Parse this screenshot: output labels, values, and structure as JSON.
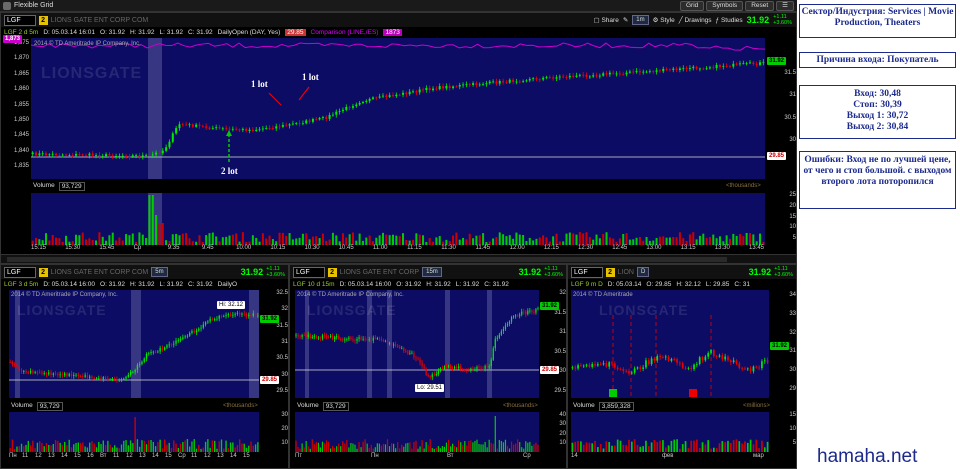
{
  "window": {
    "title": "Flexible Grid",
    "buttons": [
      "Grid",
      "Symbols",
      "Reset"
    ]
  },
  "main_chart": {
    "symbol": "LGF",
    "link": "2",
    "company": "LIONS GATE ENT CORP COM",
    "toolbar": [
      "Share",
      "1m",
      "Style",
      "Drawings",
      "Studies"
    ],
    "price": "31.92",
    "change_abs": "+1.11",
    "change_pct": "+3.60%",
    "info": [
      "LGF 2 d 5m",
      "D: 05.03.14 16:01",
      "O: 31.92",
      "H: 31.92",
      "L: 31.92",
      "C: 31.92",
      "DailyOpen (DAY, Yes)",
      "29.85",
      "Comparison (LINE,/ES)",
      "1873"
    ],
    "copyright": "2014 © TD Ameritrade IP Company, Inc.",
    "watermark": "LIONSGATE",
    "left_scale": [
      "1,875",
      "1,870",
      "1,865",
      "1,860",
      "1,855",
      "1,850",
      "1,845",
      "1,840",
      "1,835"
    ],
    "left_tag": "1,873",
    "right_scale": [
      "31.5",
      "31",
      "30.5",
      "30"
    ],
    "right_tags": {
      "last": "31.92",
      "open": "29.85"
    },
    "volume_label": "Volume",
    "volume_value": "93,729",
    "volume_unit": "<thousands>",
    "volume_scale": [
      "25",
      "20",
      "15",
      "10",
      "5"
    ],
    "time_axis": [
      "15:15",
      "15:30",
      "15:45",
      "Ср",
      "9:35",
      "9:45",
      "10:00",
      "10:15",
      "10:30",
      "10:45",
      "11:00",
      "11:15",
      "11:30",
      "11:45",
      "12:00",
      "12:15",
      "12:30",
      "12:45",
      "13:00",
      "13:15",
      "13:30",
      "13:45"
    ],
    "annotations": {
      "lot1a": "1 lot",
      "lot1b": "1 lot",
      "lot2": "2 lot"
    }
  },
  "chart_a": {
    "symbol": "LGF",
    "link": "2",
    "company": "LIONS GATE ENT CORP COM",
    "tf": "5m",
    "price": "31.92",
    "change_abs": "+1.11",
    "change_pct": "+3.60%",
    "info": [
      "LGF 3 d 5m",
      "D: 05.03.14 16:00",
      "O: 31.92",
      "H: 31.92",
      "L: 31.92",
      "C: 31.92",
      "DailyO"
    ],
    "copyright": "2014 © TD Ameritrade IP Company, Inc.",
    "hi_label": "Hi: 32.12",
    "tags": {
      "last": "31.92",
      "open": "29.85"
    },
    "right_scale": [
      "32.5",
      "32",
      "31.5",
      "31",
      "30.5",
      "30",
      "29.5"
    ],
    "volume_value": "93,729",
    "volume_unit": "<thousands>",
    "volume_scale": [
      "30",
      "20",
      "10"
    ],
    "time_axis": [
      "Пн",
      "11",
      "12",
      "13",
      "14",
      "15",
      "16",
      "Вт",
      "11",
      "12",
      "13",
      "14",
      "15",
      "Ср",
      "11",
      "12",
      "13",
      "14",
      "15"
    ]
  },
  "chart_b": {
    "symbol": "LGF",
    "link": "2",
    "company": "LIONS GATE ENT CORP",
    "tf": "15m",
    "price": "31.92",
    "change_abs": "+1.11",
    "change_pct": "+3.60%",
    "info": [
      "LGF 10 d 15m",
      "D: 05.03.14 16:00",
      "O: 31.92",
      "H: 31.92",
      "L: 31.92",
      "C: 31.92"
    ],
    "copyright": "2014 © TD Ameritrade IP Company, Inc.",
    "lo_label": "Lo: 29.51",
    "tags": {
      "last": "31.92",
      "open": "29.85"
    },
    "right_scale": [
      "32",
      "31.5",
      "31",
      "30.5",
      "30",
      "29.5"
    ],
    "volume_value": "93,729",
    "volume_unit": "<thousands>",
    "volume_scale": [
      "40",
      "30",
      "20",
      "10"
    ],
    "time_axis": [
      "Пт",
      "Пн",
      "Вт",
      "Ср"
    ]
  },
  "chart_c": {
    "symbol": "LGF",
    "link": "2",
    "company": "LION",
    "tf": "D",
    "price": "31.92",
    "change_abs": "+1.11",
    "change_pct": "+3.60%",
    "info": [
      "LGF 9 m D",
      "D: 05.03.14",
      "O: 29.85",
      "H: 32.12",
      "L: 29.85",
      "C: 31"
    ],
    "copyright": "2014 © TD Ameritrade",
    "tags": {
      "last": "31.92"
    },
    "right_scale": [
      "34",
      "33",
      "32",
      "31",
      "30",
      "29"
    ],
    "volume_value": "3,859,328",
    "volume_unit": "<millions>",
    "volume_scale": [
      "15",
      "10",
      "5"
    ],
    "time_axis": [
      "14",
      "фев",
      "мар"
    ]
  },
  "notes": {
    "sector": "Сектор/Индустрия: Services | Movie Production, Theaters",
    "reason": "Причина входа: Покупатель",
    "entry": "Вход: 30,48",
    "stop": "Стоп: 30,39",
    "exit1": "Выход 1: 30,72",
    "exit2": "Выход 2: 30,84",
    "errors": "Ошибки: Вход не по лучшей цене, от чего и стоп большой. с выходом второго лота поторопился"
  },
  "site": "hamaha.net"
}
